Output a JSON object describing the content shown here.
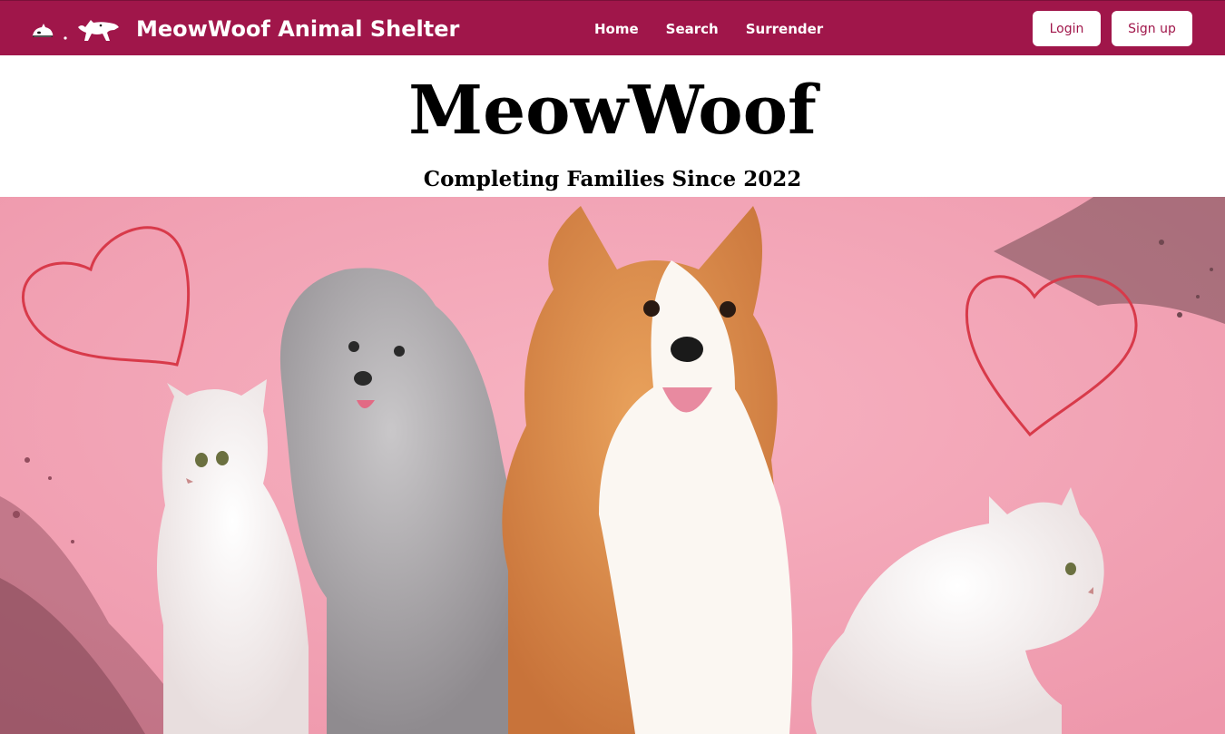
{
  "navbar": {
    "brand_name": "MeowWoof Animal Shelter",
    "logo_icon": "cat-and-dog-silhouette-icon",
    "links": [
      {
        "label": "Home"
      },
      {
        "label": "Search"
      },
      {
        "label": "Surrender"
      }
    ],
    "login_label": "Login",
    "signup_label": "Sign up"
  },
  "hero": {
    "title": "MeowWoof",
    "tagline": "Completing Families Since 2022",
    "image_alt": "Two white cats, a grey poodle and a corgi on a pink background with hand-drawn hearts"
  },
  "colors": {
    "brand": "#a0164a",
    "hero_background": "#f2a0b4",
    "heart_stroke": "#d83a4a"
  }
}
